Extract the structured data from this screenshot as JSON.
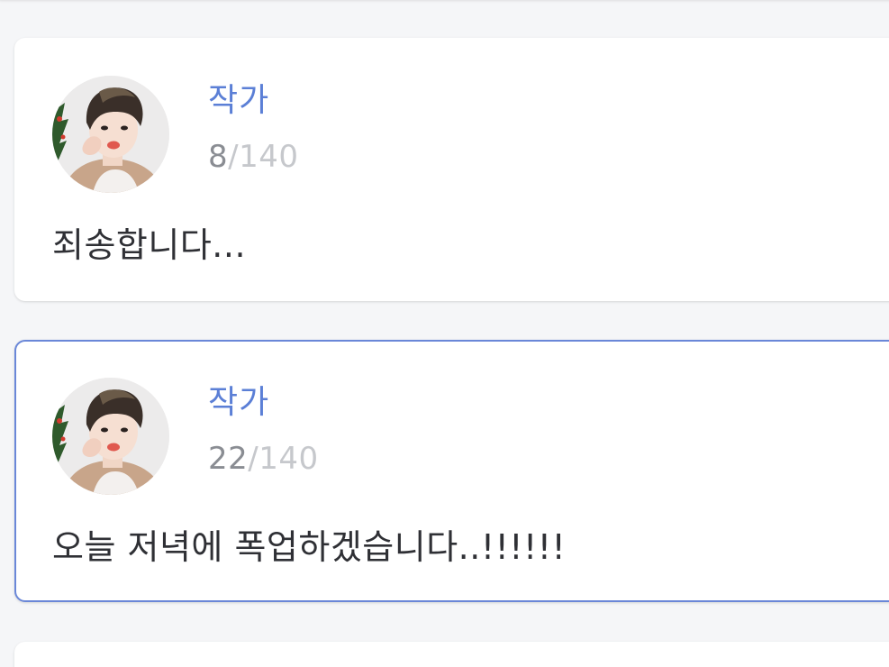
{
  "comments": [
    {
      "author": "작가",
      "count_current": "8",
      "count_separator": "/",
      "count_max": "140",
      "text": "죄송합니다..."
    },
    {
      "author": "작가",
      "count_current": "22",
      "count_separator": "/",
      "count_max": "140",
      "text": "오늘 저녁에 폭업하겠습니다..!!!!!!"
    }
  ],
  "avatar_icon": "user-photo-icon",
  "colors": {
    "accent": "#5b7fd6",
    "active_border": "#6a87d8",
    "text_primary": "#2f3035",
    "text_muted": "#8a8d93",
    "text_faint": "#c6c8cc",
    "background": "#f5f6f8"
  }
}
